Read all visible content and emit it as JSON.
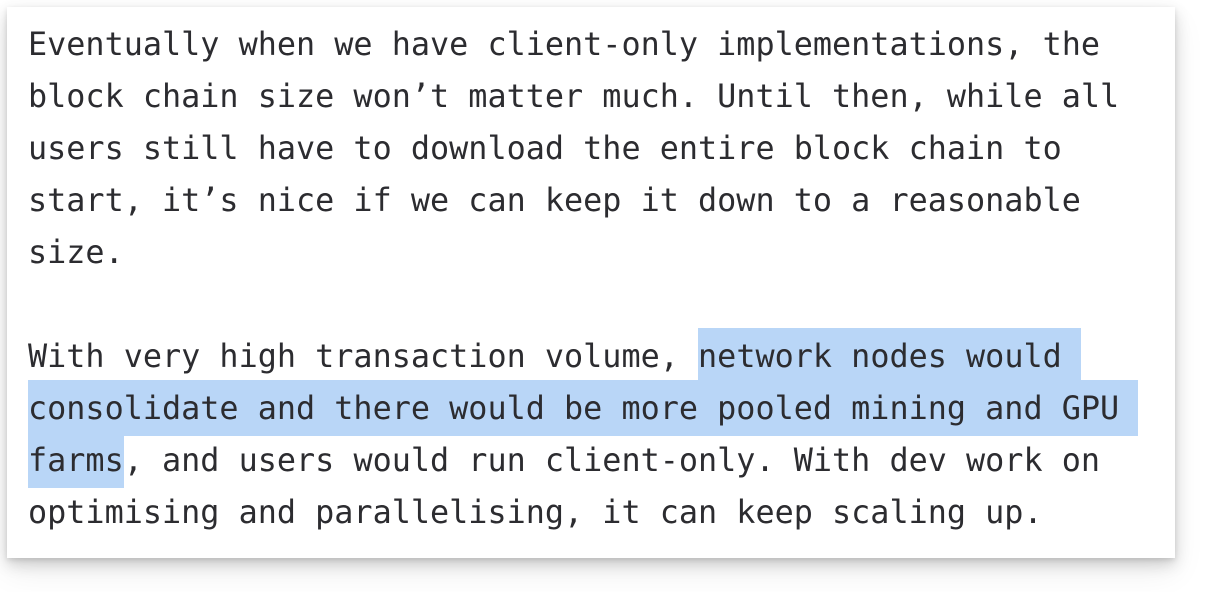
{
  "document": {
    "background_color": "#ffffff",
    "card_color": "#ffffff",
    "text_color": "#2c2c30",
    "highlight_color": "#b9d6f7",
    "paragraphs": [
      {
        "id": "paragraph-1",
        "text": "Eventually when we have client-only implementations, the block chain size won’t matter much. Until then, while all users still have to download the entire block chain to start, it’s nice if we can keep it down to a reasonable size."
      },
      {
        "id": "paragraph-2",
        "segments": {
          "before": "With very high transaction volume, ",
          "highlighted": "network nodes would consolidate and there would be more pooled mining and GPU farms",
          "after": ", and users would run client-only. With dev work on optimising and parallelising, it can keep scaling up."
        }
      }
    ]
  }
}
